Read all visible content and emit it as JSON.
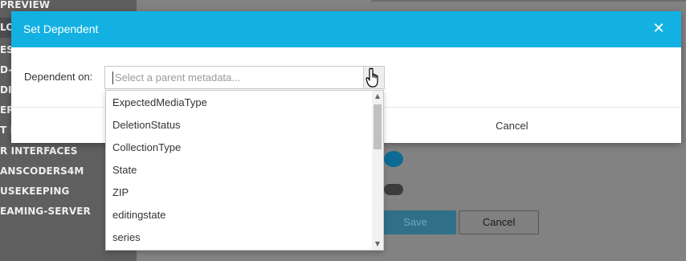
{
  "background": {
    "sidebar_items": [
      "PREVIEW",
      "LO",
      "ES",
      "D-",
      "DIA",
      "ER",
      "T M",
      "R INTERFACES",
      "ANSCODERS4M",
      "USEKEEPING",
      "EAMING-SERVER"
    ],
    "save_label": "Save",
    "cancel_label": "Cancel"
  },
  "modal": {
    "title": "Set Dependent",
    "close_symbol": "✕",
    "field_label": "Dependent on:",
    "select_placeholder": "Select a parent metadata...",
    "footer_cancel_label": "Cancel",
    "header_color": "#13b1e2"
  },
  "dropdown": {
    "options": [
      "ExpectedMediaType",
      "DeletionStatus",
      "CollectionType",
      "State",
      "ZIP",
      "editingstate",
      "series"
    ]
  },
  "icons": {
    "cursor": "hand-pointer-icon",
    "scroll_up": "chevron-up-icon",
    "scroll_down": "chevron-down-icon"
  }
}
